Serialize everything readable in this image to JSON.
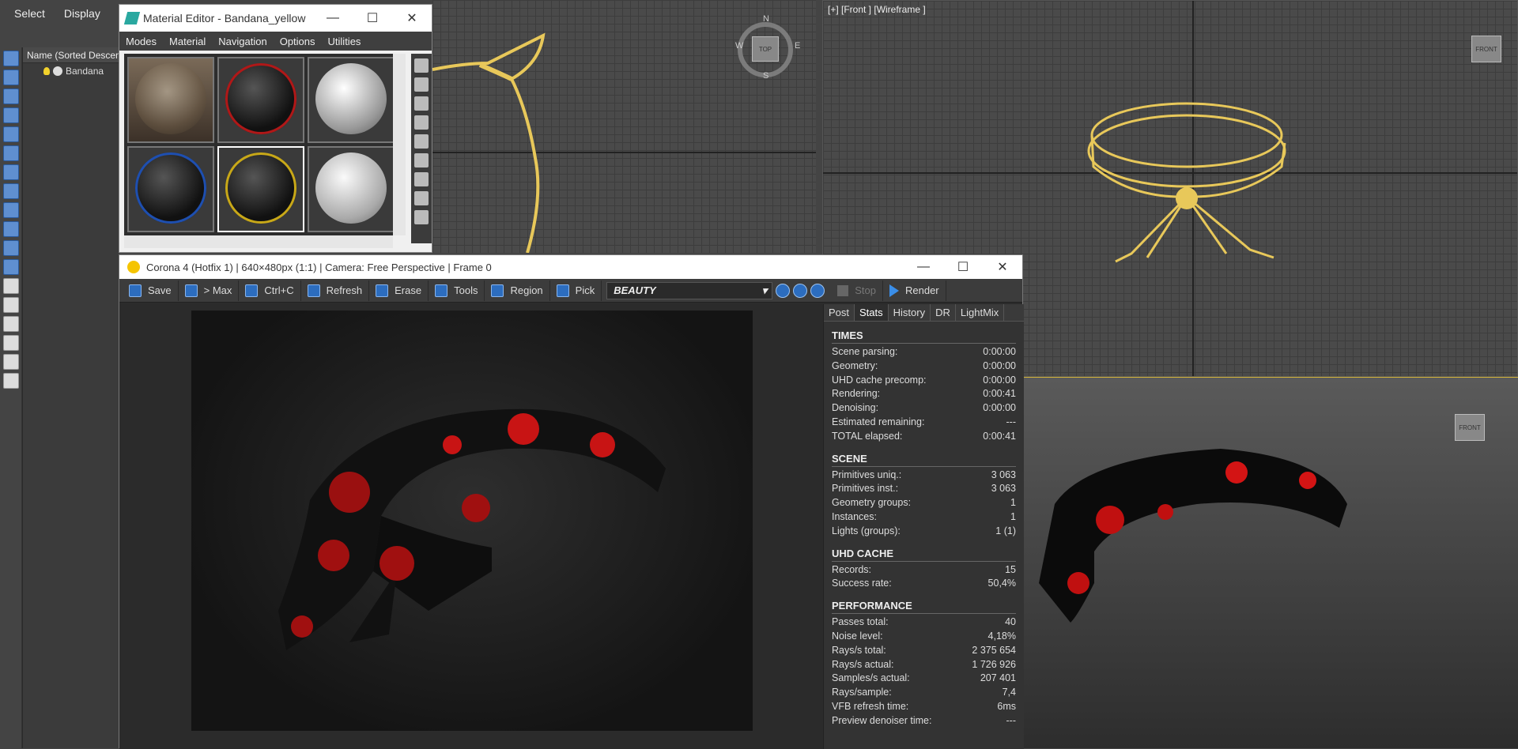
{
  "menu": {
    "select": "Select",
    "display": "Display"
  },
  "explorer": {
    "header": "Name (Sorted Descending)",
    "item": "Bandana"
  },
  "material_editor": {
    "title": "Material Editor - Bandana_yellow",
    "menu": [
      "Modes",
      "Material",
      "Navigation",
      "Options",
      "Utilities"
    ],
    "min": "—",
    "max": "☐",
    "close": "✕"
  },
  "viewport_top": {
    "compass": [
      "N",
      "W",
      "E",
      "S"
    ],
    "cube_label": "TOP"
  },
  "viewport_front": {
    "label": "[+] [Front ] [Wireframe ]",
    "cube_label": "FRONT"
  },
  "viewport_persp": {
    "cube_label": "FRONT"
  },
  "corona": {
    "title": "Corona 4 (Hotfix 1) | 640×480px (1:1) | Camera: Free Perspective | Frame 0",
    "min": "—",
    "max": "☐",
    "close": "✕",
    "toolbar": {
      "save": "Save",
      "max": "> Max",
      "copy": "Ctrl+C",
      "refresh": "Refresh",
      "erase": "Erase",
      "tools": "Tools",
      "region": "Region",
      "pick": "Pick",
      "beauty": "BEAUTY",
      "stop": "Stop",
      "render": "Render"
    },
    "tabs": [
      "Post",
      "Stats",
      "History",
      "DR",
      "LightMix"
    ],
    "sections": [
      {
        "title": "TIMES",
        "rows": [
          [
            "Scene parsing:",
            "0:00:00"
          ],
          [
            "Geometry:",
            "0:00:00"
          ],
          [
            "UHD cache precomp:",
            "0:00:00"
          ],
          [
            "Rendering:",
            "0:00:41"
          ],
          [
            "Denoising:",
            "0:00:00"
          ],
          [
            "Estimated remaining:",
            "---"
          ],
          [
            "TOTAL elapsed:",
            "0:00:41"
          ]
        ]
      },
      {
        "title": "SCENE",
        "rows": [
          [
            "Primitives uniq.:",
            "3 063"
          ],
          [
            "Primitives inst.:",
            "3 063"
          ],
          [
            "Geometry groups:",
            "1"
          ],
          [
            "Instances:",
            "1"
          ],
          [
            "Lights (groups):",
            "1 (1)"
          ]
        ]
      },
      {
        "title": "UHD CACHE",
        "rows": [
          [
            "Records:",
            "15"
          ],
          [
            "Success rate:",
            "50,4%"
          ]
        ]
      },
      {
        "title": "PERFORMANCE",
        "rows": [
          [
            "Passes total:",
            "40"
          ],
          [
            "Noise level:",
            "4,18%"
          ],
          [
            "Rays/s total:",
            "2 375 654"
          ],
          [
            "Rays/s actual:",
            "1 726 926"
          ],
          [
            "Samples/s actual:",
            "207 401"
          ],
          [
            "Rays/sample:",
            "7,4"
          ],
          [
            "VFB refresh time:",
            "6ms"
          ],
          [
            "Preview denoiser time:",
            "---"
          ]
        ]
      }
    ]
  }
}
